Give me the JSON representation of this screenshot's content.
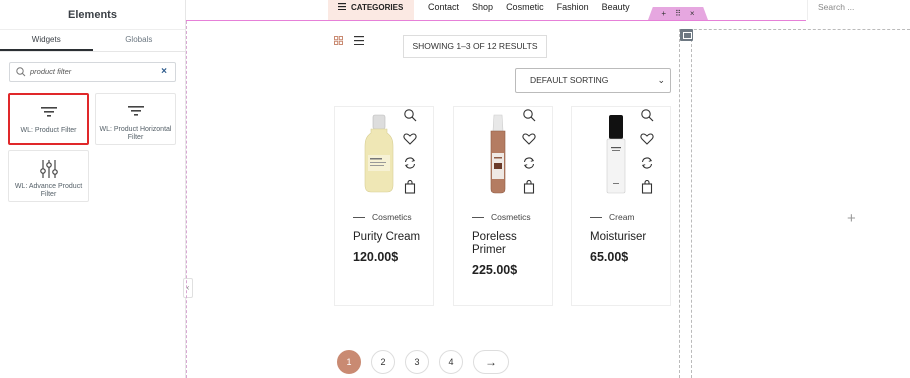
{
  "panel": {
    "title": "Elements",
    "tabs": [
      {
        "label": "Widgets"
      },
      {
        "label": "Globals"
      }
    ],
    "search": {
      "value": "product filter",
      "clear": "×"
    },
    "widgets": [
      {
        "label": "WL: Product Filter",
        "icon": "filter-icon",
        "selected": true
      },
      {
        "label": "WL: Product Horizontal Filter",
        "icon": "filter-icon",
        "selected": false
      },
      {
        "label": "WL: Advance Product Filter",
        "icon": "sliders-icon",
        "selected": false
      }
    ],
    "collapse": "‹"
  },
  "header": {
    "categories": "CATEGORIES",
    "nav": [
      "Contact",
      "Shop",
      "Cosmetic",
      "Fashion",
      "Beauty"
    ],
    "search_placeholder": "Search ...",
    "section_handle": {
      "add": "+",
      "move": "⠿",
      "close": "×"
    }
  },
  "shop": {
    "results": "SHOWING 1–3 OF 12 RESULTS",
    "sorting": "DEFAULT SORTING",
    "sorting_caret": "⌄",
    "products": [
      {
        "category": "Cosmetics",
        "name": "Purity Cream",
        "price": "120.00$"
      },
      {
        "category": "Cosmetics",
        "name": "Poreless Primer",
        "price": "225.00$"
      },
      {
        "category": "Cream",
        "name": "Moisturiser",
        "price": "65.00$"
      }
    ],
    "pagination": [
      "1",
      "2",
      "3",
      "4"
    ],
    "next": "→",
    "active_page": "1"
  },
  "empty_column": {
    "add": "+"
  },
  "colors": {
    "accent": "#c98a72",
    "selected_border": "#e0282a",
    "editor_pink": "#e6a7e0"
  }
}
